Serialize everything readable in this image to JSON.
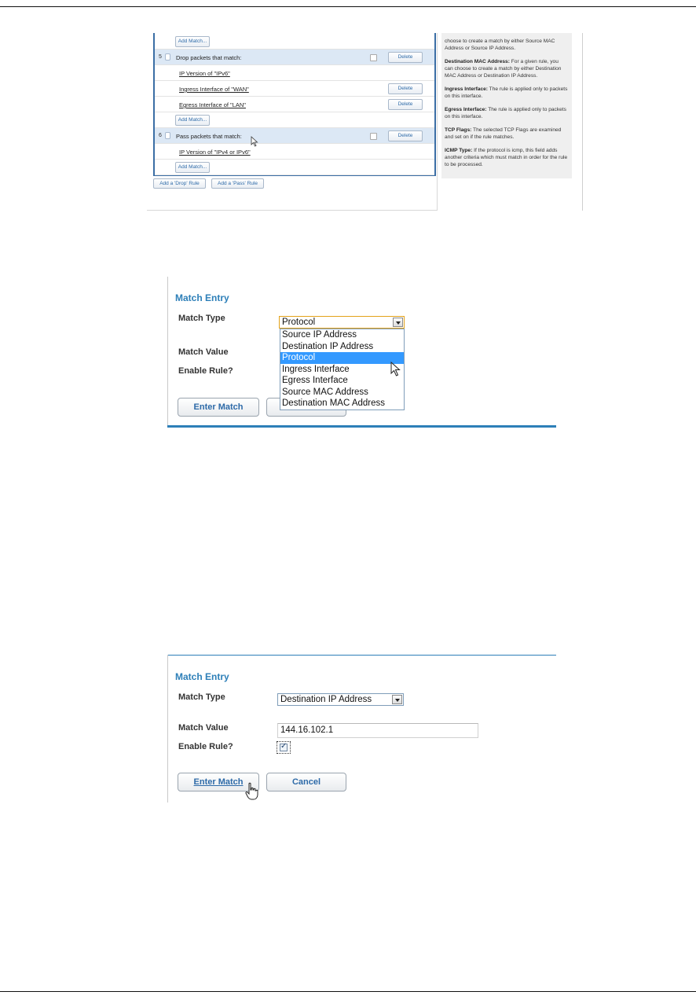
{
  "screenshot1": {
    "rows": [
      {
        "kind": "add",
        "add_label": "Add Match..."
      },
      {
        "kind": "header",
        "num": "5",
        "text": "Drop packets that match:",
        "delete_label": "Delete"
      },
      {
        "kind": "match",
        "text": "IP Version of \"IPv6\""
      },
      {
        "kind": "match",
        "text": "Ingress Interface of \"WAN\"",
        "delete_label": "Delete"
      },
      {
        "kind": "match",
        "text": "Egress Interface of \"LAN\"",
        "delete_label": "Delete"
      },
      {
        "kind": "add",
        "add_label": "Add Match..."
      },
      {
        "kind": "header",
        "num": "6",
        "text": "Pass packets that match:",
        "delete_label": "Delete"
      },
      {
        "kind": "match",
        "text": "IP Version of \"IPv4 or IPv6\""
      },
      {
        "kind": "add",
        "add_label": "Add Match..."
      }
    ],
    "add_drop_rule": "Add a 'Drop' Rule",
    "add_pass_rule": "Add a 'Pass' Rule",
    "help": [
      {
        "term": "",
        "text": "choose to create a match by either Source MAC Address or Source IP Address."
      },
      {
        "term": "Destination MAC Address:",
        "text": " For a given rule, you can choose to create a match by either Destination MAC Address or Destination IP Address."
      },
      {
        "term": "Ingress Interface:",
        "text": " The rule is applied only to packets on this interface."
      },
      {
        "term": "Egress Interface:",
        "text": " The rule is applied only to packets on this interface."
      },
      {
        "term": "TCP Flags:",
        "text": " The selected TCP Flags are examined and set on if the rule matches."
      },
      {
        "term": "ICMP Type:",
        "text": " If the protocol is icmp, this field adds another criteria which must match in order for the rule to be processed."
      }
    ]
  },
  "screenshot2": {
    "title": "Match Entry",
    "match_type_label": "Match Type",
    "match_value_label": "Match Value",
    "enable_rule_label": "Enable Rule?",
    "selected_type": "Protocol",
    "options": [
      "Source IP Address",
      "Destination IP Address",
      "Protocol",
      "Ingress Interface",
      "Egress Interface",
      "Source MAC Address",
      "Destination MAC Address"
    ],
    "highlighted_option": "Protocol",
    "enter_match": "Enter Match"
  },
  "screenshot3": {
    "title": "Match Entry",
    "match_type_label": "Match Type",
    "match_value_label": "Match Value",
    "enable_rule_label": "Enable Rule?",
    "selected_type": "Destination IP Address",
    "match_value": "144.16.102.1",
    "enable_rule_checked": true,
    "enter_match": "Enter Match",
    "cancel": "Cancel"
  }
}
